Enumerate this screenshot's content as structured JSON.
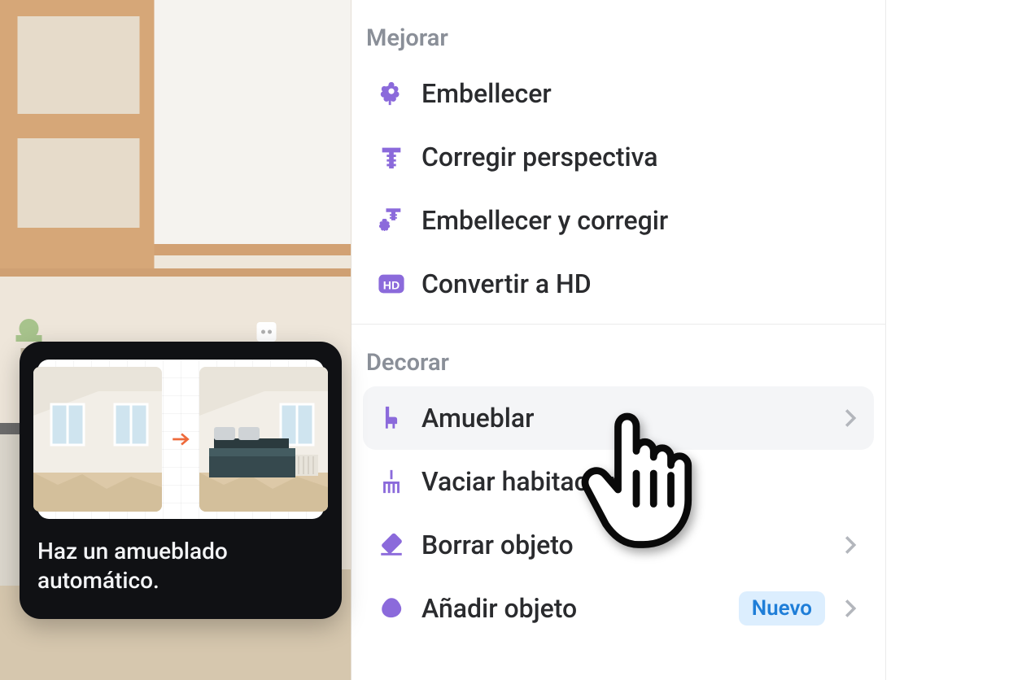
{
  "colors": {
    "accent": "#8b6adb",
    "badge_bg": "#dceefe",
    "badge_fg": "#1f7ed8"
  },
  "tooltip": {
    "text": "Haz un amueblado automático."
  },
  "sections": [
    {
      "title": "Mejorar",
      "items": [
        {
          "id": "embellecer",
          "label": "Embellecer",
          "icon": "flower-icon"
        },
        {
          "id": "corregir",
          "label": "Corregir perspectiva",
          "icon": "straighten-icon"
        },
        {
          "id": "embellecer-corregir",
          "label": "Embellecer y corregir",
          "icon": "flower-straighten-icon"
        },
        {
          "id": "hd",
          "label": "Convertir a HD",
          "icon": "hd-icon"
        }
      ]
    },
    {
      "title": "Decorar",
      "items": [
        {
          "id": "amueblar",
          "label": "Amueblar",
          "icon": "chair-icon",
          "chevron": true,
          "hover": true
        },
        {
          "id": "vaciar",
          "label": "Vaciar habitación",
          "icon": "broom-icon"
        },
        {
          "id": "borrar",
          "label": "Borrar objeto",
          "icon": "eraser-icon",
          "chevron": true
        },
        {
          "id": "anadir",
          "label": "Añadir objeto",
          "icon": "blob-icon",
          "chevron": true,
          "badge": "Nuevo"
        }
      ]
    }
  ]
}
